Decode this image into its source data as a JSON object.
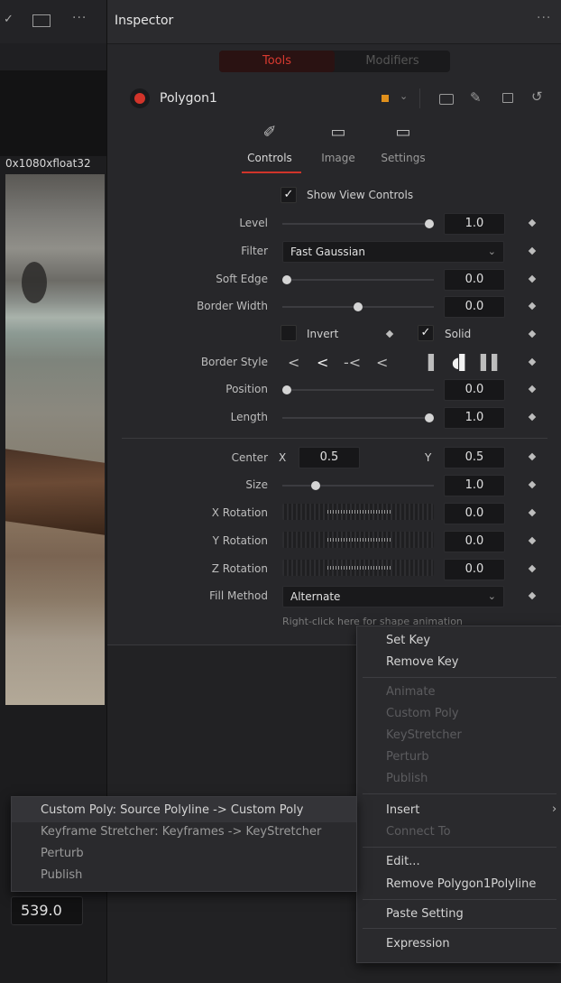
{
  "viewer": {
    "resolution": "0x1080xfloat32",
    "value": "539.0"
  },
  "inspector": {
    "title": "Inspector",
    "menu": "···",
    "segments": {
      "tools": "Tools",
      "modifiers": "Modifiers"
    },
    "node_name": "Polygon1",
    "tabs": [
      {
        "label": "Controls"
      },
      {
        "label": "Image"
      },
      {
        "label": "Settings"
      }
    ],
    "show_view_controls": "Show View Controls",
    "level": {
      "label": "Level",
      "value": "1.0",
      "fraction": 1.0
    },
    "filter": {
      "label": "Filter",
      "value": "Fast Gaussian"
    },
    "soft_edge": {
      "label": "Soft Edge",
      "value": "0.0",
      "fraction": 0.0
    },
    "border_width": {
      "label": "Border Width",
      "value": "0.0",
      "fraction": 0.5
    },
    "invert": "Invert",
    "solid": "Solid",
    "border_style": {
      "label": "Border Style"
    },
    "position": {
      "label": "Position",
      "value": "0.0",
      "fraction": 0.0
    },
    "length": {
      "label": "Length",
      "value": "1.0",
      "fraction": 1.0
    },
    "center": {
      "label": "Center",
      "x_label": "X",
      "x_value": "0.5",
      "y_label": "Y",
      "y_value": "0.5"
    },
    "size": {
      "label": "Size",
      "value": "1.0",
      "fraction": 0.2
    },
    "x_rotation": {
      "label": "X Rotation",
      "value": "0.0"
    },
    "y_rotation": {
      "label": "Y Rotation",
      "value": "0.0"
    },
    "z_rotation": {
      "label": "Z Rotation",
      "value": "0.0"
    },
    "fill_method": {
      "label": "Fill Method",
      "value": "Alternate"
    },
    "hint": "Right-click here for shape animation"
  },
  "context_menu": {
    "items": [
      "Set Key",
      "Remove Key",
      "Animate",
      "Custom Poly",
      "KeyStretcher",
      "Perturb",
      "Publish",
      "Insert",
      "Connect To",
      "Edit...",
      "Remove Polygon1Polyline",
      "Paste Setting",
      "Expression"
    ]
  },
  "submenu": {
    "items": [
      "Custom Poly: Source Polyline -> Custom Poly",
      "Keyframe Stretcher: Keyframes -> KeyStretcher",
      "Perturb",
      "Publish"
    ]
  },
  "colors": {
    "accent": "#d0342a",
    "node_color": "#e0901c",
    "panel": "#27272a"
  }
}
